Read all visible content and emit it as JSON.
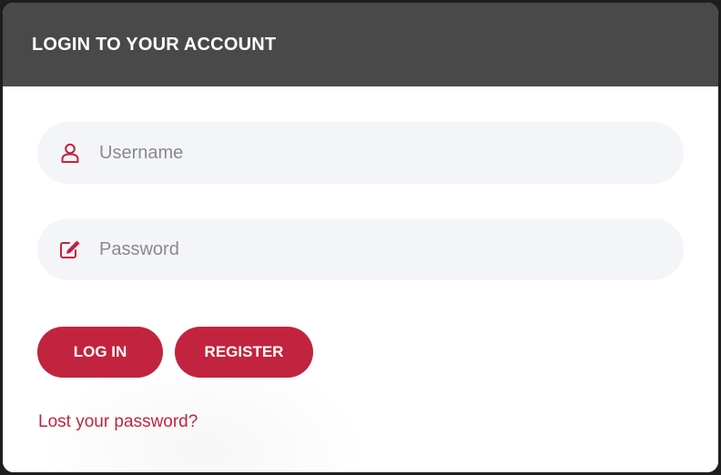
{
  "modal": {
    "title": "LOGIN TO YOUR ACCOUNT"
  },
  "form": {
    "username": {
      "placeholder": "Username",
      "value": "",
      "icon": "user-icon"
    },
    "password": {
      "placeholder": "Password",
      "value": "",
      "icon": "edit-icon"
    },
    "login_label": "LOG IN",
    "register_label": "REGISTER",
    "forgot_label": "Lost your password?"
  },
  "colors": {
    "header_bg": "#494949",
    "accent": "#c2233f",
    "field_bg": "#f4f5f8"
  }
}
